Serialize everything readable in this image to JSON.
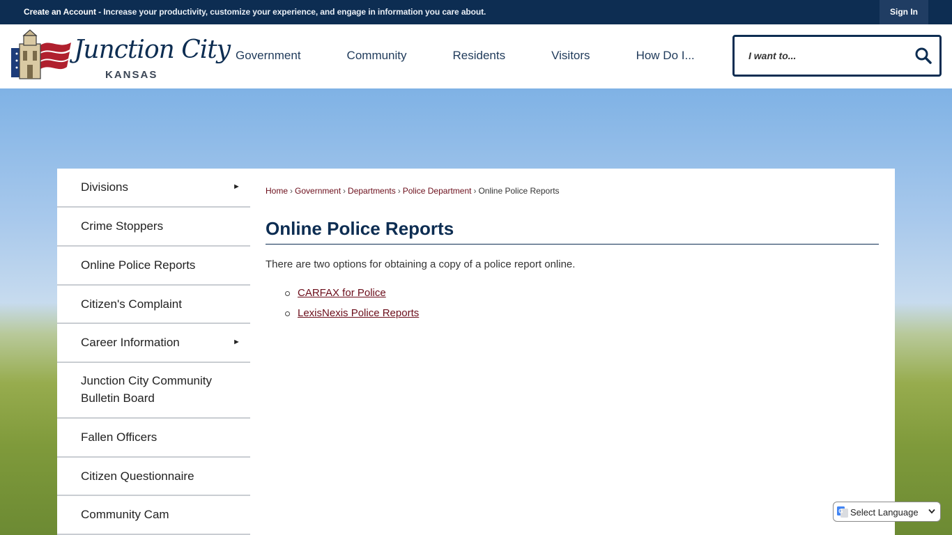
{
  "topbar": {
    "promo_strong": "Create an Account",
    "promo_rest": " - Increase your productivity, customize your experience, and engage in information you care about.",
    "sign_in": "Sign In"
  },
  "logo": {
    "script": "Junction City",
    "state": "KANSAS"
  },
  "nav": [
    "Government",
    "Community",
    "Residents",
    "Visitors",
    "How Do I..."
  ],
  "search": {
    "placeholder": "I want to..."
  },
  "sidebar": {
    "items": [
      {
        "label": "Divisions",
        "has_submenu": true
      },
      {
        "label": "Crime Stoppers",
        "has_submenu": false
      },
      {
        "label": "Online Police Reports",
        "has_submenu": false
      },
      {
        "label": "Citizen's Complaint",
        "has_submenu": false
      },
      {
        "label": "Career Information",
        "has_submenu": true
      },
      {
        "label": "Junction City Community Bulletin Board",
        "has_submenu": false
      },
      {
        "label": "Fallen Officers",
        "has_submenu": false
      },
      {
        "label": "Citizen Questionnaire",
        "has_submenu": false
      },
      {
        "label": "Community Cam",
        "has_submenu": false
      }
    ]
  },
  "breadcrumb": {
    "links": [
      "Home",
      "Government",
      "Departments",
      "Police Department"
    ],
    "current": "Online Police Reports"
  },
  "page": {
    "title": "Online Police Reports",
    "intro": "There are two options for obtaining a copy of a police report online.",
    "links": [
      "CARFAX for Police",
      "LexisNexis Police Reports"
    ]
  },
  "translate": {
    "label": "Select Language"
  },
  "colors": {
    "navy": "#0d2d52",
    "link_maroon": "#6b0d1a"
  }
}
